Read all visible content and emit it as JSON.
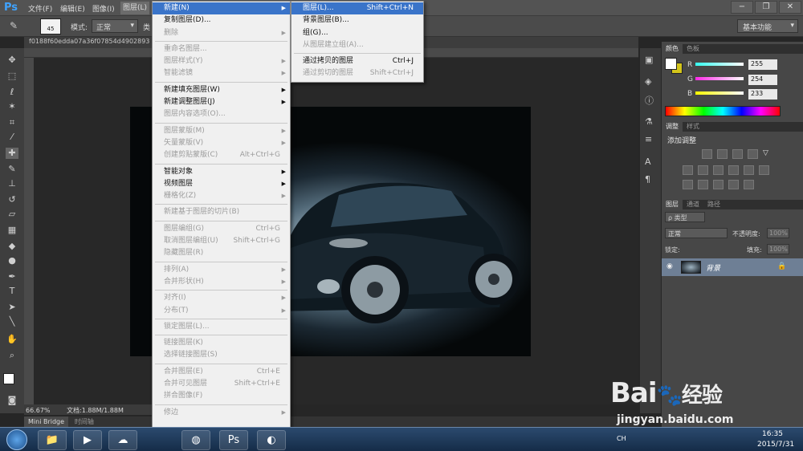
{
  "app": {
    "logo": "Ps",
    "mode_label": "基本功能"
  },
  "menubar": [
    "文件(F)",
    "编辑(E)",
    "图像(I)",
    "图层(L)"
  ],
  "window_controls": [
    "−",
    "❐",
    "✕"
  ],
  "options": {
    "size": "45",
    "mode_label": "模式:",
    "mode_value": "正常",
    "trunc": "类"
  },
  "doc_tab": "f0188f60edda07a36f07854d4902893",
  "status": {
    "zoom": "66.67%",
    "doc": "文档:1.88M/1.88M"
  },
  "bottom_tabs": [
    "Mini Bridge",
    "时间轴"
  ],
  "layer_menu": [
    {
      "label": "新建(N)",
      "arrow": true,
      "state": "hl"
    },
    {
      "label": "复制图层(D)..."
    },
    {
      "label": "删除",
      "arrow": true,
      "state": "dis"
    },
    {
      "sep": true
    },
    {
      "label": "重命名图层...",
      "state": "dis"
    },
    {
      "label": "图层样式(Y)",
      "arrow": true,
      "state": "dis"
    },
    {
      "label": "智能滤镜",
      "arrow": true,
      "state": "dis"
    },
    {
      "sep": true
    },
    {
      "label": "新建填充图层(W)",
      "arrow": true
    },
    {
      "label": "新建调整图层(J)",
      "arrow": true
    },
    {
      "label": "图层内容选项(O)...",
      "state": "dis"
    },
    {
      "sep": true
    },
    {
      "label": "图层蒙版(M)",
      "arrow": true,
      "state": "dis"
    },
    {
      "label": "矢量蒙版(V)",
      "arrow": true,
      "state": "dis"
    },
    {
      "label": "创建剪贴蒙版(C)",
      "shortcut": "Alt+Ctrl+G",
      "state": "dis"
    },
    {
      "sep": true
    },
    {
      "label": "智能对象",
      "arrow": true
    },
    {
      "label": "视频图层",
      "arrow": true
    },
    {
      "label": "栅格化(Z)",
      "arrow": true,
      "state": "dis"
    },
    {
      "sep": true
    },
    {
      "label": "新建基于图层的切片(B)",
      "state": "dis"
    },
    {
      "sep": true
    },
    {
      "label": "图层编组(G)",
      "shortcut": "Ctrl+G",
      "state": "dis"
    },
    {
      "label": "取消图层编组(U)",
      "shortcut": "Shift+Ctrl+G",
      "state": "dis"
    },
    {
      "label": "隐藏图层(R)",
      "state": "dis"
    },
    {
      "sep": true
    },
    {
      "label": "排列(A)",
      "arrow": true,
      "state": "dis"
    },
    {
      "label": "合并形状(H)",
      "arrow": true,
      "state": "dis"
    },
    {
      "sep": true
    },
    {
      "label": "对齐(I)",
      "arrow": true,
      "state": "dis"
    },
    {
      "label": "分布(T)",
      "arrow": true,
      "state": "dis"
    },
    {
      "sep": true
    },
    {
      "label": "锁定图层(L)...",
      "state": "dis"
    },
    {
      "sep": true
    },
    {
      "label": "链接图层(K)",
      "state": "dis"
    },
    {
      "label": "选择链接图层(S)",
      "state": "dis"
    },
    {
      "sep": true
    },
    {
      "label": "合并图层(E)",
      "shortcut": "Ctrl+E",
      "state": "dis"
    },
    {
      "label": "合并可见图层",
      "shortcut": "Shift+Ctrl+E",
      "state": "dis"
    },
    {
      "label": "拼合图像(F)",
      "state": "dis"
    },
    {
      "sep": true
    },
    {
      "label": "修边",
      "arrow": true,
      "state": "dis"
    }
  ],
  "new_submenu": [
    {
      "label": "图层(L)...",
      "shortcut": "Shift+Ctrl+N",
      "state": "hl"
    },
    {
      "label": "背景图层(B)..."
    },
    {
      "label": "组(G)..."
    },
    {
      "label": "从图层建立组(A)...",
      "state": "dis"
    },
    {
      "sep": true
    },
    {
      "label": "通过拷贝的图层",
      "shortcut": "Ctrl+J"
    },
    {
      "label": "通过剪切的图层",
      "shortcut": "Shift+Ctrl+J",
      "state": "dis"
    }
  ],
  "color_panel": {
    "tabs": [
      "颜色",
      "色板"
    ],
    "r_label": "R",
    "g_label": "G",
    "b_label": "B",
    "r": "255",
    "g": "254",
    "b": "233",
    "fg": "#ffffff",
    "bg": "#d4c51a"
  },
  "adjust_panel": {
    "tabs": [
      "调整",
      "样式"
    ],
    "title": "添加调整"
  },
  "layers_panel": {
    "tabs": [
      "图层",
      "通道",
      "路径"
    ],
    "kind": "ρ 类型",
    "blend": "正常",
    "opacity_label": "不透明度:",
    "opacity": "100%",
    "lock_label": "锁定:",
    "fill_label": "填充:",
    "fill": "100%",
    "layer_name": "背景"
  },
  "taskbar": {
    "time": "16:35",
    "date": "2015/7/31",
    "lang": "CH"
  },
  "watermark": {
    "brand": "Bai",
    "brand2": "经验",
    "url": "jingyan.baidu.com"
  }
}
